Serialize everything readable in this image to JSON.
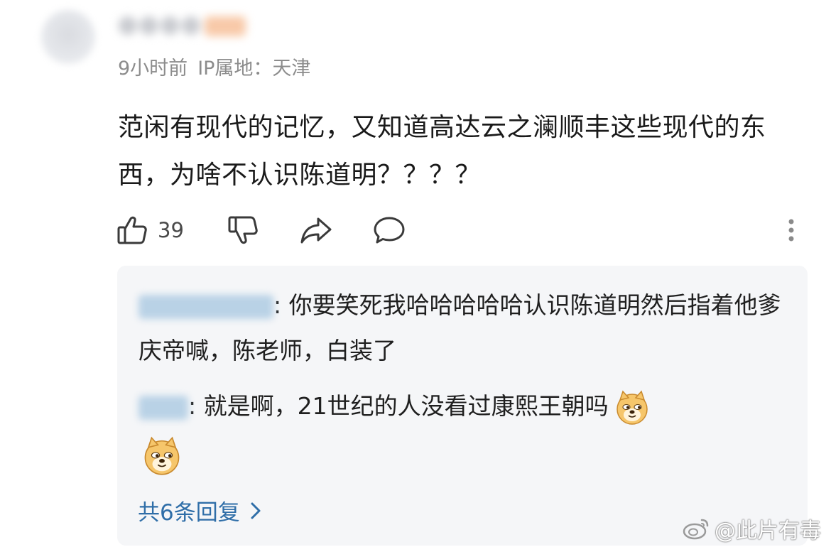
{
  "comment": {
    "username": "",
    "time": "9小时前",
    "ip_location": "IP属地：天津",
    "text": "范闲有现代的记忆，又知道高达云之澜顺丰这些现代的东西，为啥不认识陈道明？？？？",
    "likes": "39"
  },
  "icons": {
    "like": "thumbs-up-icon",
    "dislike": "thumbs-down-icon",
    "share": "share-arrow-icon",
    "reply": "comment-bubble-icon",
    "more": "more-vertical-icon",
    "emoji": "doge-emoji-icon",
    "chevron": "chevron-right-icon"
  },
  "replies": [
    {
      "text": "你要笑死我哈哈哈哈哈认识陈道明然后指着他爹庆帝喊，陈老师，白装了"
    },
    {
      "text": "就是啊，21世纪的人没看过康熙王朝吗"
    }
  ],
  "total_replies_label": "共6条回复",
  "watermark": "@此片有毒",
  "colors": {
    "link": "#2f6ea8",
    "reply_bg": "#f5f6f8",
    "meta_text": "#8c8c8c"
  }
}
